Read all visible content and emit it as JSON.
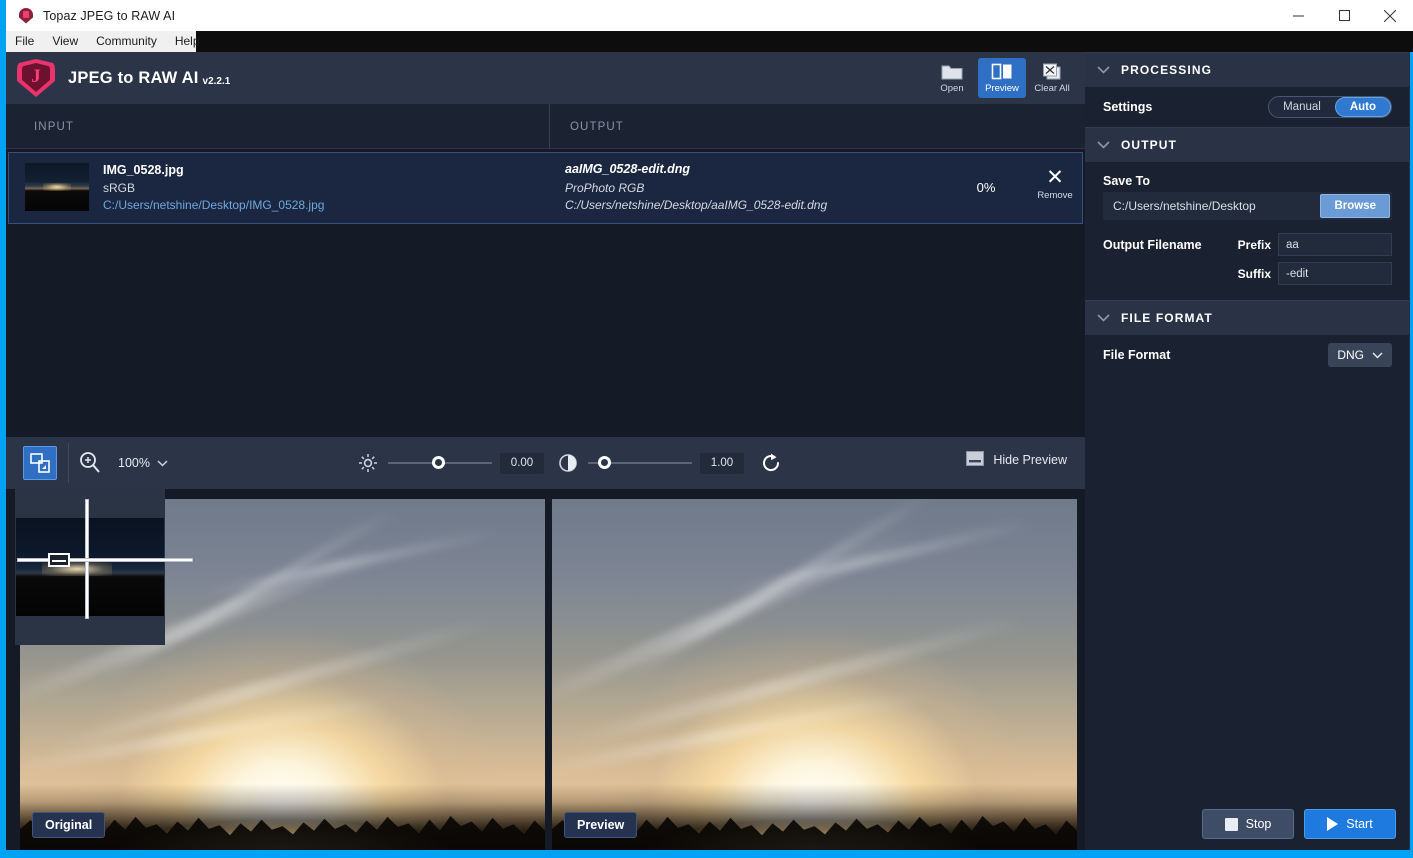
{
  "window": {
    "title": "Topaz JPEG to RAW AI",
    "app_icon": "topaz-shield-icon",
    "controls": {
      "minimize": "minimize-icon",
      "maximize": "maximize-icon",
      "close": "close-icon"
    }
  },
  "menubar": {
    "items": [
      "File",
      "View",
      "Community",
      "Help"
    ]
  },
  "brand": {
    "logo": "topaz-j-logo",
    "title": "JPEG to RAW AI",
    "version": "v2.2.1",
    "toolbuttons": [
      {
        "label": "Open",
        "icon": "folder-icon",
        "active": false
      },
      {
        "label": "Preview",
        "icon": "split-preview-icon",
        "active": true
      },
      {
        "label": "Clear All",
        "icon": "clear-all-icon",
        "active": false
      }
    ]
  },
  "columns": {
    "input": "INPUT",
    "output": "OUTPUT"
  },
  "files": [
    {
      "thumbnail": "sunset-thumbnail",
      "input_name": "IMG_0528.jpg",
      "input_colorspace": "sRGB",
      "input_path": "C:/Users/netshine/Desktop/IMG_0528.jpg",
      "output_name": "aaIMG_0528-edit.dng",
      "output_colorspace": "ProPhoto RGB",
      "output_path": "C:/Users/netshine/Desktop/aaIMG_0528-edit.dng",
      "progress": "0%",
      "remove_label": "Remove"
    }
  ],
  "preview_toolbar": {
    "fit_icon": "fit-to-window-icon",
    "zoom_icon": "zoom-in-icon",
    "zoom_level": "100%",
    "zoom_chevron": "chevron-down-icon",
    "brightness": {
      "icon": "brightness-icon",
      "value": "0.00",
      "knob_pct": 50
    },
    "contrast": {
      "icon": "contrast-icon",
      "value": "1.00",
      "knob_pct": 12
    },
    "reset_icon": "reset-icon",
    "hide_preview_label": "Hide Preview",
    "hide_preview_icon": "panel-icon"
  },
  "compare": {
    "navigator": "navigator-thumbnail",
    "left_label": "Original",
    "right_label": "Preview"
  },
  "panel": {
    "sections": [
      {
        "id": "processing",
        "title": "PROCESSING",
        "chevron": "chevron-down-icon",
        "settings_label": "Settings",
        "mode_options": [
          "Manual",
          "Auto"
        ],
        "mode_selected": "Auto"
      },
      {
        "id": "output",
        "title": "OUTPUT",
        "chevron": "chevron-down-icon",
        "save_to_label": "Save To",
        "save_to_value": "C:/Users/netshine/Desktop",
        "browse_label": "Browse",
        "output_filename_label": "Output Filename",
        "prefix_label": "Prefix",
        "prefix_value": "aa",
        "suffix_label": "Suffix",
        "suffix_value": "-edit"
      },
      {
        "id": "file_format",
        "title": "FILE FORMAT",
        "chevron": "chevron-down-icon",
        "format_label": "File Format",
        "format_value": "DNG",
        "format_chevron": "chevron-down-icon"
      }
    ],
    "actions": {
      "stop_label": "Stop",
      "stop_icon": "stop-icon",
      "start_label": "Start",
      "start_icon": "play-icon"
    }
  },
  "colors": {
    "accent_blue": "#2f7ad0",
    "brand_pink": "#e8336c",
    "panel_bg": "#1a2130",
    "section_header_bg": "#2a3346",
    "toolbar_bg": "#2c3547",
    "list_bg": "#141a26",
    "row_selected_bg": "#1b2740",
    "link_blue": "#6fa8dc",
    "desktop_blue": "#00a2f3"
  }
}
